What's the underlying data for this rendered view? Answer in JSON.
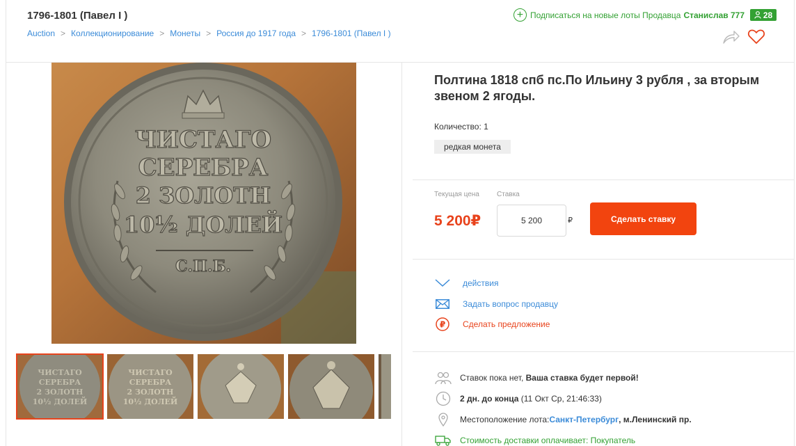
{
  "page_title": "1796-1801 (Павел I )",
  "breadcrumb": [
    "Auction",
    "Коллекционирование",
    "Монеты",
    "Россия до 1917 года",
    "1796-1801 (Павел I )"
  ],
  "seller": {
    "subscribe_text": "Подписаться на новые лоты Продавца",
    "name": "Станислав 777",
    "rating": "28"
  },
  "lot": {
    "title": "Полтина 1818 спб пс.По Ильину 3 рубля , за вторым звеном 2 ягоды.",
    "quantity": "Количество: 1",
    "tag": "редкая монета",
    "coin_inscription": [
      "ЧИСТАГО",
      "СЕРЕБРА",
      "2 ЗОЛОТН",
      "10½ ДОЛЕЙ",
      "С.П.Б."
    ]
  },
  "pricing": {
    "current_label": "Текущая цена",
    "bid_label": "Ставка",
    "current_price": "5 200₽",
    "bid_value": "5 200",
    "currency_mark": "₽",
    "bid_button": "Сделать ставку"
  },
  "actions": {
    "actions_link": "действия",
    "ask_seller": "Задать вопрос продавцу",
    "make_offer": "Сделать предложение"
  },
  "info": {
    "bids_text": "Ставок пока нет,",
    "bids_bold": "Ваша ставка будет первой!",
    "time_bold": "2 дн. до конца",
    "time_rest": "(11 Окт Ср, 21:46:33)",
    "location_label": "Местоположение лота:",
    "location_city": "Санкт-Петербург",
    "location_rest": ", м.Ленинский пр.",
    "delivery": "Стоимость доставки оплачивает: Покупатель"
  },
  "colors": {
    "accent_orange": "#f2440f",
    "price_red": "#e8431c",
    "link_blue": "#3b8bd8",
    "seller_green": "#33a133"
  },
  "icons": [
    "plus-circle-icon",
    "user-badge-icon",
    "share-icon",
    "heart-icon",
    "chevron-down-icon",
    "envelope-icon",
    "ruble-circle-icon",
    "users-icon",
    "clock-icon",
    "map-pin-icon",
    "truck-icon"
  ]
}
